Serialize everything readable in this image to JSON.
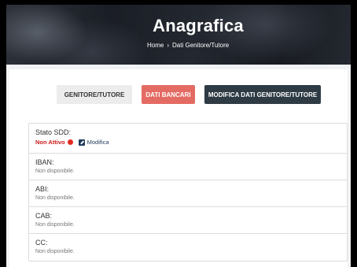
{
  "header": {
    "title": "Anagrafica",
    "breadcrumb": {
      "home": "Home",
      "separator": "›",
      "current": "Dati Genitore/Tutore"
    }
  },
  "tabs": [
    {
      "label": "GENITORE/TUTORE",
      "active": false
    },
    {
      "label": "DATI BANCARI",
      "active": true
    },
    {
      "label": "MODIFICA DATI GENITORE/TUTORE",
      "active": false
    }
  ],
  "bank": {
    "sdd": {
      "label": "Stato SDD:",
      "status": "Non Attivo",
      "status_color": "#cc1b1b",
      "edit_label": "Modifica"
    },
    "fields": [
      {
        "label": "IBAN:",
        "value": "Non disponibile."
      },
      {
        "label": "ABI:",
        "value": "Non disponibile."
      },
      {
        "label": "CAB:",
        "value": "Non disponibile."
      },
      {
        "label": "CC:",
        "value": "Non disponibile."
      }
    ]
  },
  "colors": {
    "accent": "#e46b63",
    "dark_button": "#2f3b44",
    "link": "#1f3b5c"
  }
}
